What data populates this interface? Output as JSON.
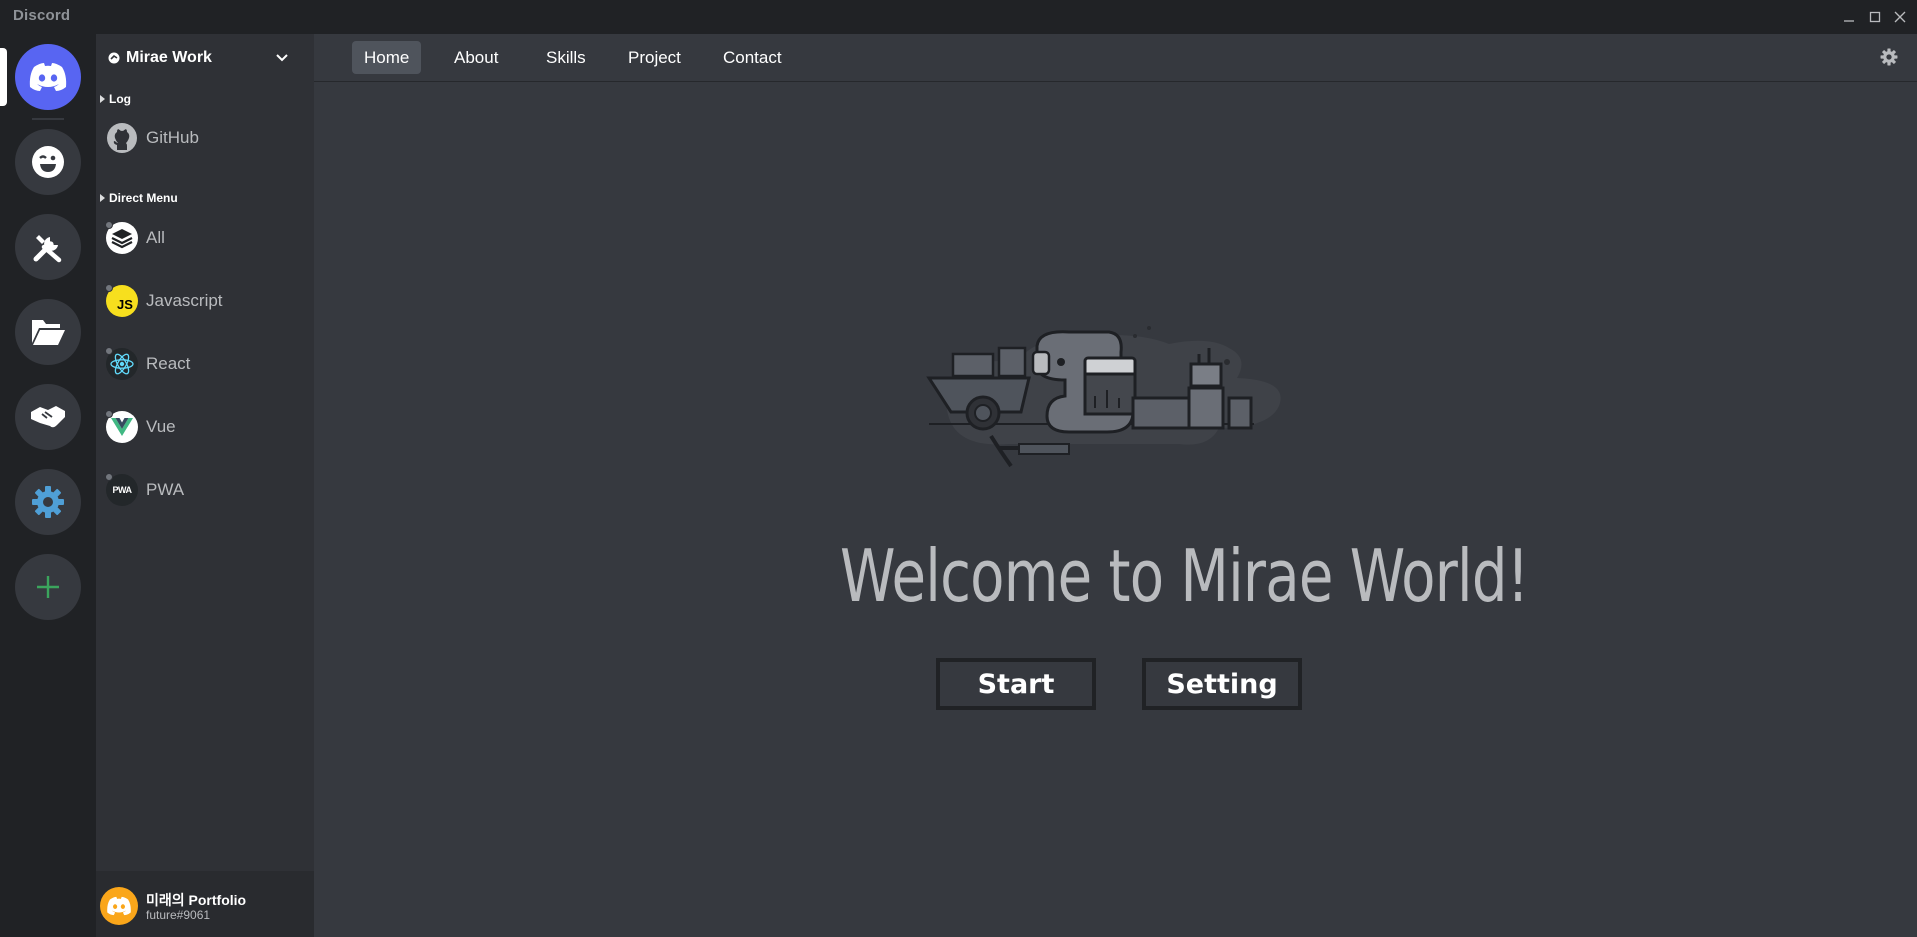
{
  "titlebar": {
    "app_name": "Discord"
  },
  "rail": {
    "items": [
      {
        "name": "discord-home",
        "icon": "discord-logo-icon"
      },
      {
        "name": "emoji",
        "icon": "winking-face-icon"
      },
      {
        "name": "skills",
        "icon": "tools-icon"
      },
      {
        "name": "project",
        "icon": "open-folder-icon"
      },
      {
        "name": "contact",
        "icon": "handshake-icon"
      },
      {
        "name": "setting",
        "icon": "gear-icon"
      },
      {
        "name": "add",
        "icon": "plus-icon"
      }
    ],
    "accent": "#5865f2",
    "add_color": "#3ba55d"
  },
  "server": {
    "name": "Mirae Work"
  },
  "categories": [
    {
      "label": "Log",
      "items": [
        {
          "label": "GitHub",
          "icon": "github-icon"
        }
      ]
    },
    {
      "label": "Direct Menu",
      "items": [
        {
          "label": "All",
          "icon": "layers-icon"
        },
        {
          "label": "Javascript",
          "icon": "javascript-icon",
          "badge": "JS"
        },
        {
          "label": "React",
          "icon": "react-icon"
        },
        {
          "label": "Vue",
          "icon": "vue-icon"
        },
        {
          "label": "PWA",
          "icon": "pwa-icon",
          "badge": "PWA"
        }
      ]
    }
  ],
  "user": {
    "name": "미래의 Portfolio",
    "tag": "future#9061"
  },
  "nav": {
    "tabs": [
      "Home",
      "About",
      "Skills",
      "Project",
      "Contact"
    ],
    "active": "Home"
  },
  "hero": {
    "title": "Welcome to Mirae World!",
    "start_label": "Start",
    "setting_label": "Setting"
  }
}
